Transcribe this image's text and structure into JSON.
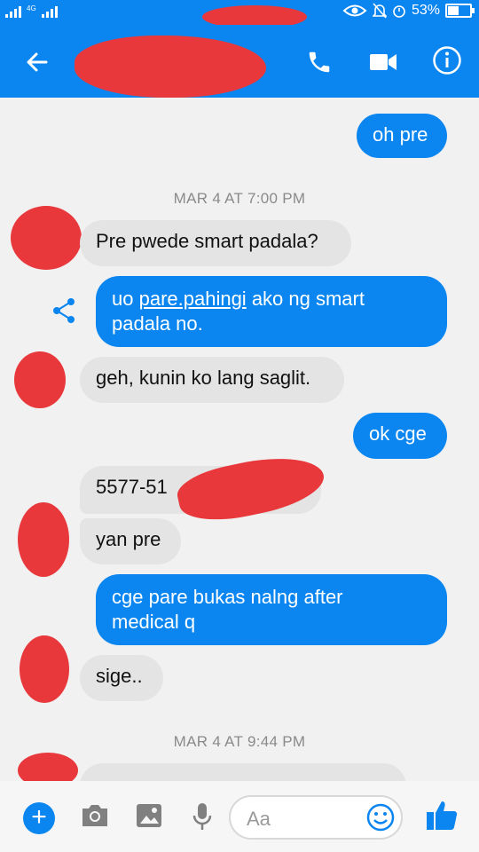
{
  "status_bar": {
    "network": "4G",
    "battery": "53%",
    "battery_level": 0.53
  },
  "header": {
    "contact_suffix": "...",
    "icons": [
      "back-arrow-icon",
      "phone-icon",
      "video-camera-icon",
      "info-icon"
    ]
  },
  "messages": [
    {
      "dir": "out",
      "text": "oh pre"
    },
    {
      "type": "timestamp",
      "text": "MAR 4 AT 7:00 PM"
    },
    {
      "dir": "in",
      "text": "Pre pwede smart padala?"
    },
    {
      "dir": "out",
      "parts": [
        "uo ",
        "pare.pahingi",
        " ako ng smart"
      ],
      "line2": "padala no."
    },
    {
      "dir": "in",
      "text": "geh, kunin ko lang saglit."
    },
    {
      "dir": "out",
      "text": "ok cge"
    },
    {
      "dir": "in",
      "text": "5577-51"
    },
    {
      "dir": "in",
      "text": "yan pre"
    },
    {
      "dir": "out",
      "line1": "cge pare bukas nalng after",
      "line2": "medical q"
    },
    {
      "dir": "in",
      "text": "sige.."
    },
    {
      "type": "timestamp",
      "text": "MAR 4 AT 9:44 PM"
    }
  ],
  "composer": {
    "placeholder": "Aa"
  },
  "colors": {
    "accent": "#0b86f0",
    "incoming": "#e4e4e4",
    "redaction": "#e8383b"
  }
}
